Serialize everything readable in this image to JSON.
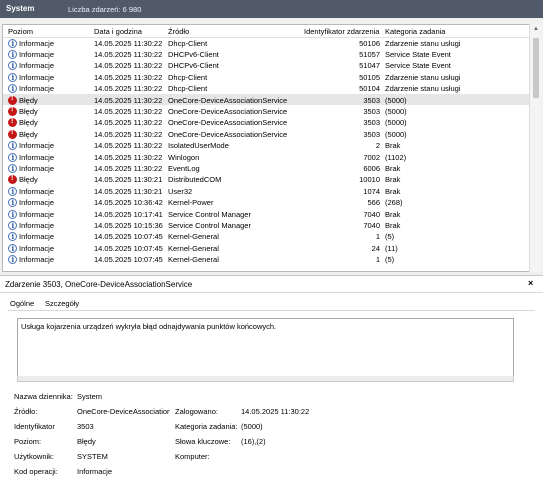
{
  "header": {
    "tab": "System",
    "event_count": "Liczba zdarzeń: 6 980"
  },
  "columns": [
    "Poziom",
    "Data i godzina",
    "Źródło",
    "Identyfikator zdarzenia",
    "Kategoria zadania"
  ],
  "rows": [
    {
      "level": "Informacje",
      "type": "info",
      "date": "14.05.2025 11:30:22",
      "source": "Dhcp-Client",
      "id": "50106",
      "category": "Zdarzenie stanu usługi"
    },
    {
      "level": "Informacje",
      "type": "info",
      "date": "14.05.2025 11:30:22",
      "source": "DHCPv6-Client",
      "id": "51057",
      "category": "Service State Event"
    },
    {
      "level": "Informacje",
      "type": "info",
      "date": "14.05.2025 11:30:22",
      "source": "DHCPv6-Client",
      "id": "51047",
      "category": "Service State Event"
    },
    {
      "level": "Informacje",
      "type": "info",
      "date": "14.05.2025 11:30:22",
      "source": "Dhcp-Client",
      "id": "50105",
      "category": "Zdarzenie stanu usługi"
    },
    {
      "level": "Informacje",
      "type": "info",
      "date": "14.05.2025 11:30:22",
      "source": "Dhcp-Client",
      "id": "50104",
      "category": "Zdarzenie stanu usługi"
    },
    {
      "level": "Błędy",
      "type": "err",
      "date": "14.05.2025 11:30:22",
      "source": "OneCore-DeviceAssociationService",
      "id": "3503",
      "category": "(5000)",
      "selected": true
    },
    {
      "level": "Błędy",
      "type": "err",
      "date": "14.05.2025 11:30:22",
      "source": "OneCore-DeviceAssociationService",
      "id": "3503",
      "category": "(5000)"
    },
    {
      "level": "Błędy",
      "type": "err",
      "date": "14.05.2025 11:30:22",
      "source": "OneCore-DeviceAssociationService",
      "id": "3503",
      "category": "(5000)"
    },
    {
      "level": "Błędy",
      "type": "err",
      "date": "14.05.2025 11:30:22",
      "source": "OneCore-DeviceAssociationService",
      "id": "3503",
      "category": "(5000)"
    },
    {
      "level": "Informacje",
      "type": "info",
      "date": "14.05.2025 11:30:22",
      "source": "IsolatedUserMode",
      "id": "2",
      "category": "Brak"
    },
    {
      "level": "Informacje",
      "type": "info",
      "date": "14.05.2025 11:30:22",
      "source": "Winlogon",
      "id": "7002",
      "category": "(1102)"
    },
    {
      "level": "Informacje",
      "type": "info",
      "date": "14.05.2025 11:30:22",
      "source": "EventLog",
      "id": "6006",
      "category": "Brak"
    },
    {
      "level": "Błędy",
      "type": "err",
      "date": "14.05.2025 11:30:21",
      "source": "DistributedCOM",
      "id": "10010",
      "category": "Brak"
    },
    {
      "level": "Informacje",
      "type": "info",
      "date": "14.05.2025 11:30:21",
      "source": "User32",
      "id": "1074",
      "category": "Brak"
    },
    {
      "level": "Informacje",
      "type": "info",
      "date": "14.05.2025 10:36:42",
      "source": "Kernel-Power",
      "id": "566",
      "category": "(268)"
    },
    {
      "level": "Informacje",
      "type": "info",
      "date": "14.05.2025 10:17:41",
      "source": "Service Control Manager",
      "id": "7040",
      "category": "Brak"
    },
    {
      "level": "Informacje",
      "type": "info",
      "date": "14.05.2025 10:15:36",
      "source": "Service Control Manager",
      "id": "7040",
      "category": "Brak"
    },
    {
      "level": "Informacje",
      "type": "info",
      "date": "14.05.2025 10:07:45",
      "source": "Kernel-General",
      "id": "1",
      "category": "(5)"
    },
    {
      "level": "Informacje",
      "type": "info",
      "date": "14.05.2025 10:07:45",
      "source": "Kernel-General",
      "id": "24",
      "category": "(11)"
    },
    {
      "level": "Informacje",
      "type": "info",
      "date": "14.05.2025 10:07:45",
      "source": "Kernel-General",
      "id": "1",
      "category": "(5)"
    }
  ],
  "detail": {
    "title": "Zdarzenie 3503, OneCore-DeviceAssociationService",
    "close": "×",
    "tab_general": "Ogólne",
    "tab_details": "Szczegóły",
    "message": "Usługa kojarzenia urządzeń wykryła błąd odnajdywania punktów końcowych.",
    "log_name_label": "Nazwa dziennika:",
    "log_name": "System",
    "source_label": "Źródło:",
    "source": "OneCore-DeviceAssociationS",
    "logged_label": "Zalogowano:",
    "logged": "14.05.2025 11:30:22",
    "id_label": "Identyfikator",
    "id": "3503",
    "task_label": "Kategoria zadania:",
    "task": "(5000)",
    "level_label": "Poziom:",
    "level": "Błędy",
    "keywords_label": "Słowa kluczowe:",
    "keywords": "(16),(2)",
    "user_label": "Użytkownik:",
    "user": "SYSTEM",
    "computer_label": "Komputer:",
    "opcode_label": "Kod operacji:",
    "opcode": "Informacje"
  }
}
